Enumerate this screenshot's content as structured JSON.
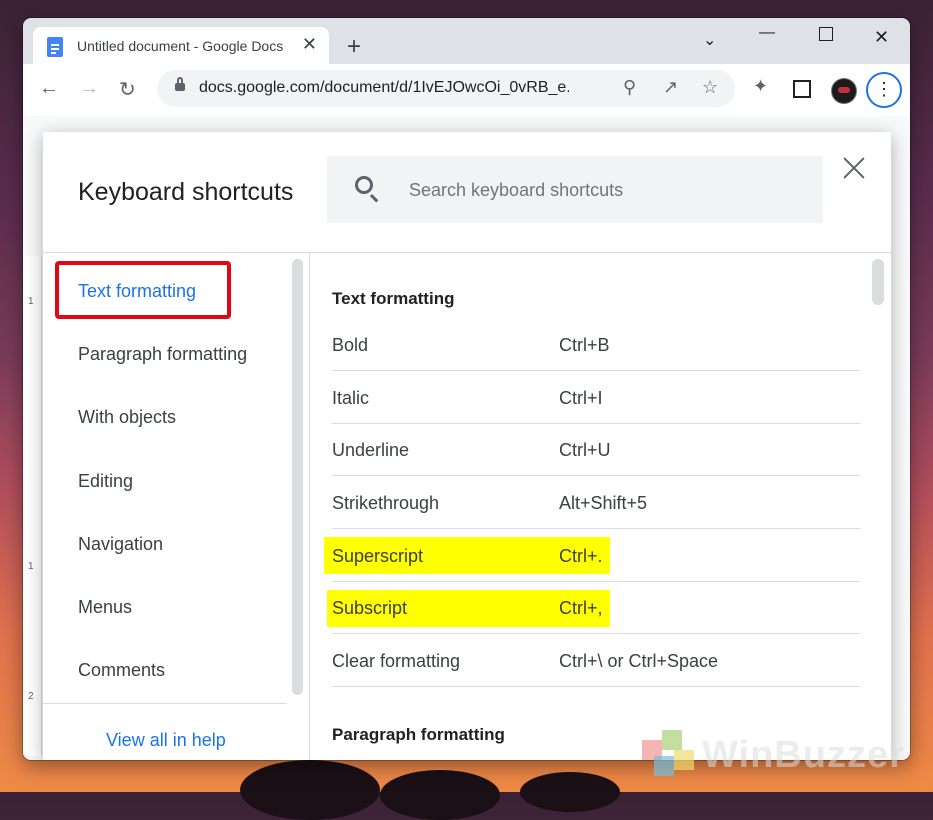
{
  "browser": {
    "tab_title": "Untitled document - Google Docs",
    "url": "docs.google.com/document/d/1IvEJOwcOi_0vRB_e...",
    "new_tab_symbol": "+",
    "close_symbol": "✕"
  },
  "dialog": {
    "title": "Keyboard shortcuts",
    "search_placeholder": "Search keyboard shortcuts",
    "nav": [
      {
        "label": "Text formatting",
        "active": true
      },
      {
        "label": "Paragraph formatting"
      },
      {
        "label": "With objects"
      },
      {
        "label": "Editing"
      },
      {
        "label": "Navigation"
      },
      {
        "label": "Menus"
      },
      {
        "label": "Comments"
      }
    ],
    "view_all": "View all in help",
    "section_title": "Text formatting",
    "shortcuts": [
      {
        "name": "Bold",
        "keys": "Ctrl+B"
      },
      {
        "name": "Italic",
        "keys": "Ctrl+I"
      },
      {
        "name": "Underline",
        "keys": "Ctrl+U"
      },
      {
        "name": "Strikethrough",
        "keys": "Alt+Shift+5"
      },
      {
        "name": "Superscript",
        "keys": "Ctrl+.",
        "highlighted": true
      },
      {
        "name": "Subscript",
        "keys": "Ctrl+,",
        "highlighted": true
      },
      {
        "name": "Clear formatting",
        "keys": "Ctrl+\\ or Ctrl+Space"
      }
    ],
    "next_section_title": "Paragraph formatting"
  },
  "ruler": {
    "marks": [
      "1",
      "1",
      "2"
    ]
  },
  "watermark": {
    "text": "WinBuzzer"
  },
  "colors": {
    "accent": "#1a73e8",
    "highlight": "#ffff00",
    "annotation_box": "#e30613"
  }
}
